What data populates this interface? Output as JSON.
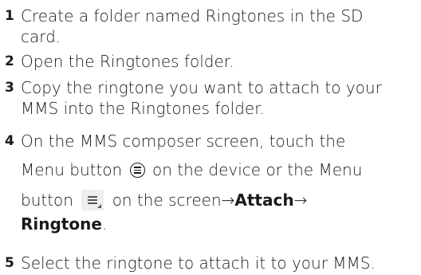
{
  "steps": [
    {
      "number": "1",
      "lines": [
        "Create a folder named Ringtones in the SD",
        "card."
      ]
    },
    {
      "number": "2",
      "lines": [
        "Open the Ringtones folder."
      ]
    },
    {
      "number": "3",
      "lines": [
        "Copy the ringtone you want to attach to your",
        "MMS into the Ringtones folder."
      ]
    },
    {
      "number": "4",
      "line1": "On the MMS composer screen, touch the",
      "line2_a": "Menu button",
      "line2_b": "on the device or the Menu",
      "line3_a": "button",
      "line3_b": "on the screen→",
      "line3_bold": "Attach",
      "line3_arrow": "→",
      "line4_bold": "Ringtone",
      "line4_end": "."
    },
    {
      "number": "5",
      "lines": [
        "Select the ringtone to attach it to your MMS."
      ]
    }
  ],
  "icons": {
    "menu_hardware_icon": "menu-circle-icon",
    "menu_onscreen_icon": "menu-box-icon"
  }
}
